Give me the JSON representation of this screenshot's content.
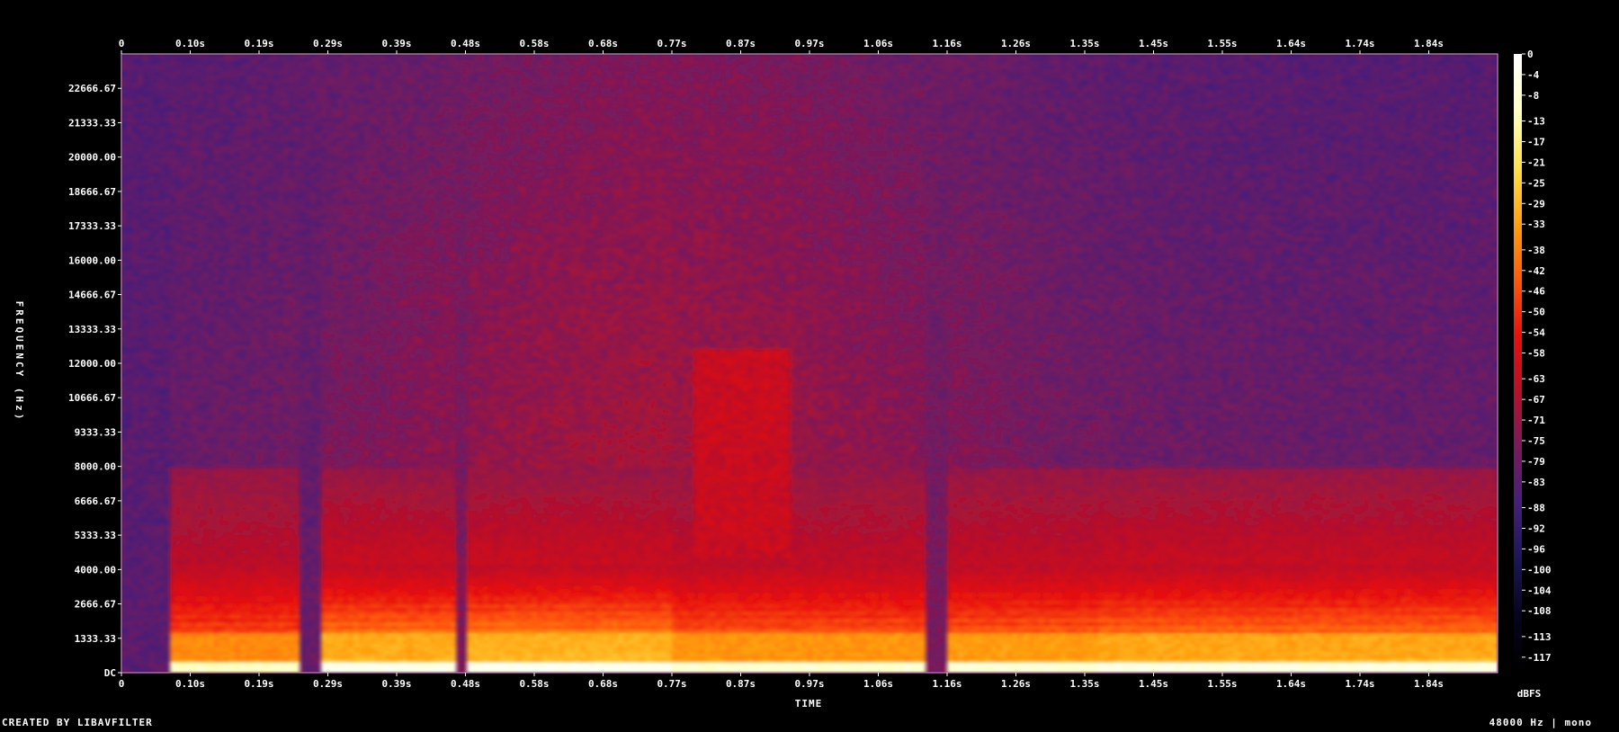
{
  "chart_data": {
    "type": "heatmap",
    "title": "",
    "xlabel": "TIME",
    "ylabel": "FREQUENCY (Hz)",
    "x_unit": "s",
    "y_unit": "Hz",
    "xlim": [
      0,
      1.92
    ],
    "ylim": [
      0,
      24000
    ],
    "x_ticks": [
      "0",
      "0.10s",
      "0.19s",
      "0.29s",
      "0.39s",
      "0.48s",
      "0.58s",
      "0.68s",
      "0.77s",
      "0.87s",
      "0.97s",
      "1.06s",
      "1.16s",
      "1.26s",
      "1.35s",
      "1.45s",
      "1.55s",
      "1.64s",
      "1.74s",
      "1.84s"
    ],
    "x_tick_values": [
      0,
      0.096,
      0.192,
      0.288,
      0.384,
      0.48,
      0.576,
      0.672,
      0.768,
      0.864,
      0.96,
      1.056,
      1.152,
      1.248,
      1.344,
      1.44,
      1.536,
      1.632,
      1.728,
      1.824
    ],
    "y_ticks": [
      "DC",
      "1333.33",
      "2666.67",
      "4000.00",
      "5333.33",
      "6666.67",
      "8000.00",
      "9333.33",
      "10666.67",
      "12000.00",
      "13333.33",
      "14666.67",
      "16000.00",
      "17333.33",
      "18666.67",
      "20000.00",
      "21333.33",
      "22666.67"
    ],
    "y_tick_values": [
      0,
      1333.33,
      2666.67,
      4000,
      5333.33,
      6666.67,
      8000,
      9333.33,
      10666.67,
      12000,
      13333.33,
      14666.67,
      16000,
      17333.33,
      18666.67,
      20000,
      21333.33,
      22666.67
    ],
    "colorbar": {
      "label": "dBFS",
      "ticks": [
        "0",
        "-4",
        "-8",
        "-13",
        "-17",
        "-21",
        "-25",
        "-29",
        "-33",
        "-38",
        "-42",
        "-46",
        "-50",
        "-54",
        "-58",
        "-63",
        "-67",
        "-71",
        "-75",
        "-79",
        "-83",
        "-88",
        "-92",
        "-96",
        "-100",
        "-104",
        "-108",
        "-113",
        "-117"
      ],
      "range": [
        -120,
        0
      ],
      "colormap": [
        "#ffffff",
        "#ffffc0",
        "#ffe14a",
        "#ffa10f",
        "#ff5a0a",
        "#e8100e",
        "#b8102a",
        "#7a1a5c",
        "#46207a",
        "#1e1658",
        "#060420",
        "#000000"
      ]
    },
    "segments": [
      {
        "start": 0.07,
        "end": 0.25,
        "level": 0.65
      },
      {
        "start": 0.28,
        "end": 0.47,
        "level": 0.95
      },
      {
        "start": 0.48,
        "end": 0.77,
        "level": 1.0
      },
      {
        "start": 0.77,
        "end": 1.12,
        "level": 0.75
      },
      {
        "start": 1.15,
        "end": 1.36,
        "level": 0.8
      },
      {
        "start": 1.36,
        "end": 1.92,
        "level": 0.9
      }
    ],
    "grid": false,
    "legend": "none"
  },
  "footer": {
    "left": "CREATED BY LIBAVFILTER",
    "right": "48000 Hz | mono"
  },
  "colors": {
    "background": "#000000",
    "axis": "#ffffff",
    "plot_border": "#cc88cc"
  }
}
